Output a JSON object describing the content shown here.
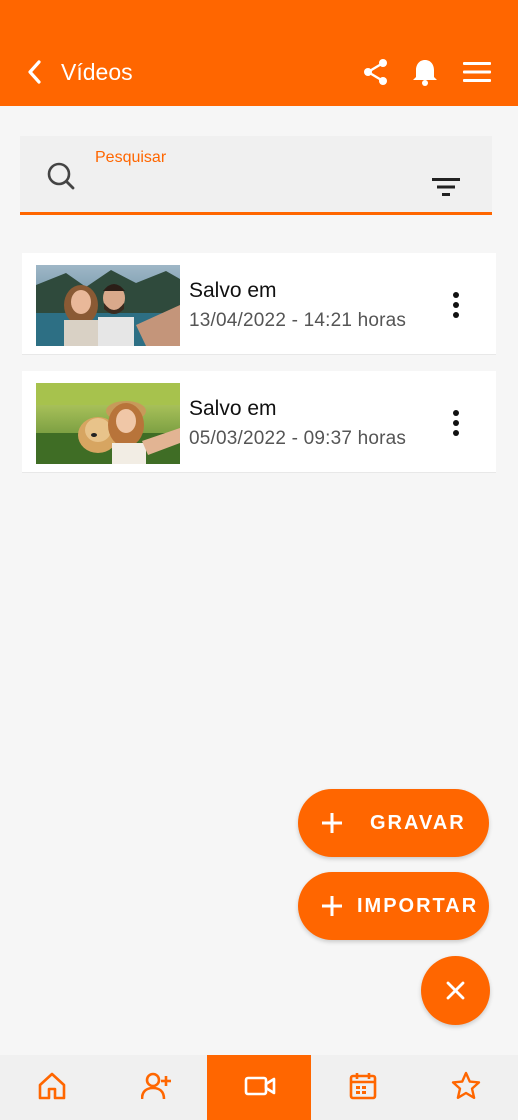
{
  "colors": {
    "accent": "#ff6600",
    "background": "#f6f6f6",
    "card": "#ffffff"
  },
  "header": {
    "title": "Vídeos",
    "icons": [
      "back-chevron-icon",
      "share-icon",
      "bell-icon",
      "menu-icon"
    ]
  },
  "search": {
    "label": "Pesquisar",
    "value": "",
    "icons": [
      "search-icon",
      "filter-icon"
    ]
  },
  "videos": [
    {
      "title": "Salvo em",
      "datetime": "13/04/2022 - 14:21 horas",
      "thumbnail": "couple selfie by lake"
    },
    {
      "title": "Salvo em",
      "datetime": "05/03/2022 - 09:37 horas",
      "thumbnail": "woman selfie with dog"
    }
  ],
  "actions": {
    "record_label": "GRAVAR",
    "import_label": "IMPORTAR",
    "close_icon": "close-icon"
  },
  "bottom_nav": {
    "items": [
      "home-icon",
      "add-user-icon",
      "video-camera-icon",
      "calendar-icon",
      "star-icon"
    ],
    "active": "video-camera-icon"
  }
}
